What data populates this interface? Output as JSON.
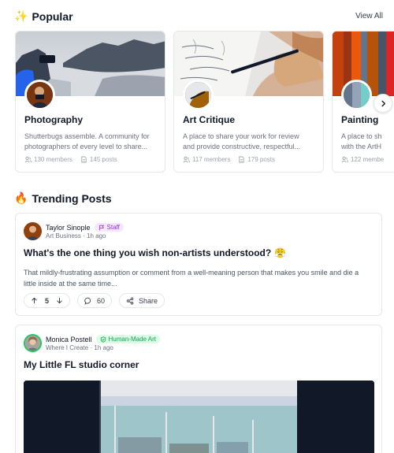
{
  "popular": {
    "title": "Popular",
    "emoji": "✨",
    "view_all": "View All",
    "cards": [
      {
        "name": "Photography",
        "desc_lines": [
          "Shutterbugs assemble. A community for",
          "photographers of every level to share..."
        ],
        "members": "130 members",
        "posts": "145 posts"
      },
      {
        "name": "Art Critique",
        "desc_lines": [
          "A place to share your work for review",
          "and provide constructive, respectful..."
        ],
        "members": "117 members",
        "posts": "179 posts"
      },
      {
        "name": "Painting",
        "desc_lines": [
          "A place to sh",
          "with the ArtH"
        ],
        "members": "122 membe",
        "posts": ""
      }
    ]
  },
  "trending": {
    "title": "Trending Posts",
    "emoji": "🔥",
    "posts": [
      {
        "author": "Taylor Sinople",
        "badge": "Staff",
        "community": "Art Business",
        "time": "1h ago",
        "title": "What's the one thing you wish non-artists understood?",
        "title_emoji": "😤",
        "body_lines": [
          "That mildly-frustrating assumption or comment from a well-meaning person that makes you smile and die a",
          "little inside at the same time..."
        ],
        "votes": "5",
        "comments": "60",
        "share_label": "Share"
      },
      {
        "author": "Monica Postell",
        "badge": "Human-Made Art",
        "community": "Where I Create",
        "time": "1h ago",
        "title": "My Little FL studio corner"
      }
    ]
  },
  "colors": {
    "staff_badge": "#9333ea",
    "human_badge": "#16a34a",
    "accent_avatar_ring": "#22c55e"
  }
}
